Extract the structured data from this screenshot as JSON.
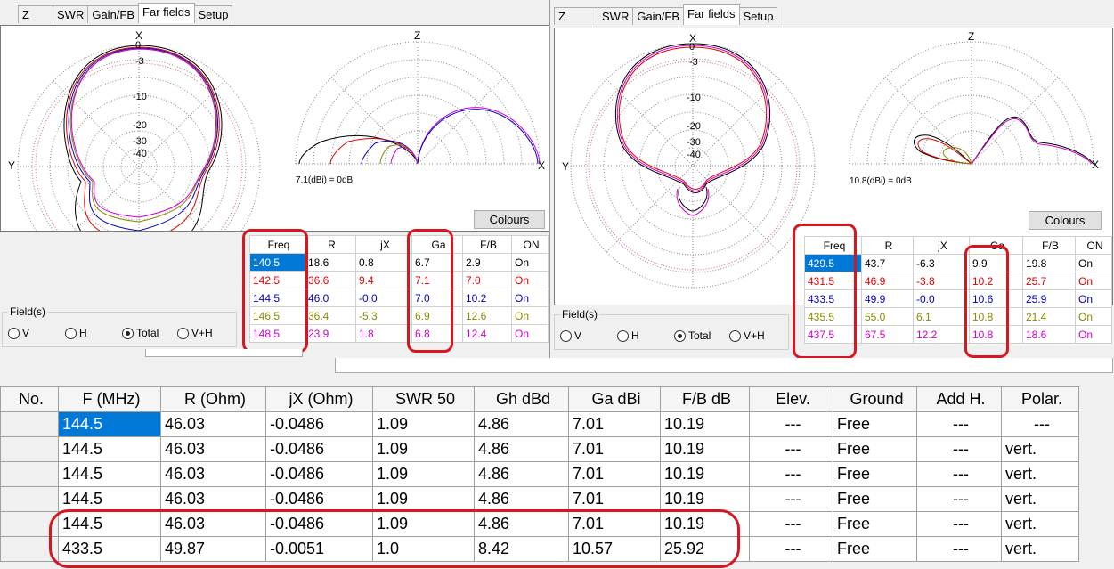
{
  "tabs": [
    "Z",
    "SWR",
    "Gain/FB",
    "Far fields",
    "Setup"
  ],
  "active_tab": "Far fields",
  "left": {
    "axis_labels": {
      "x_top": "X",
      "y_left": "Y",
      "z_top": "Z",
      "x_right": "X"
    },
    "ring_labels": [
      "0",
      "-3",
      "-10",
      "-20",
      "-30",
      "-40"
    ],
    "scale_text": "7.1(dBi) = 0dB",
    "colours_button": "Colours",
    "table": {
      "headers": [
        "Freq",
        "R",
        "jX",
        "Ga",
        "F/B",
        "ON"
      ],
      "rows": [
        {
          "color": "#000000",
          "cells": [
            "140.5",
            "18.6",
            "0.8",
            "6.7",
            "2.9",
            "On"
          ]
        },
        {
          "color": "#e00000",
          "cells": [
            "142.5",
            "36.6",
            "9.4",
            "7.1",
            "7.0",
            "On"
          ]
        },
        {
          "color": "#0000c8",
          "cells": [
            "144.5",
            "46.0",
            "-0.0",
            "7.0",
            "10.2",
            "On"
          ]
        },
        {
          "color": "#8a8a00",
          "cells": [
            "146.5",
            "36.4",
            "-5.3",
            "6.9",
            "12.6",
            "On"
          ]
        },
        {
          "color": "#d000d0",
          "cells": [
            "148.5",
            "23.9",
            "1.8",
            "6.8",
            "12.4",
            "On"
          ]
        }
      ]
    },
    "fields": {
      "legend": "Field(s)",
      "options": [
        "V",
        "H",
        "Total",
        "V+H"
      ],
      "selected": "Total"
    }
  },
  "right": {
    "axis_labels": {
      "x_top": "X",
      "y_left": "Y",
      "z_top": "Z",
      "x_right": "X"
    },
    "ring_labels": [
      "0",
      "-3",
      "-10",
      "-20",
      "-30",
      "-40"
    ],
    "scale_text": "10.8(dBi) = 0dB",
    "colours_button": "Colours",
    "table": {
      "headers": [
        "Freq",
        "R",
        "jX",
        "Ga",
        "F/B",
        "ON"
      ],
      "rows": [
        {
          "color": "#000000",
          "cells": [
            "429.5",
            "43.7",
            "-6.3",
            "9.9",
            "19.8",
            "On"
          ]
        },
        {
          "color": "#e00000",
          "cells": [
            "431.5",
            "46.9",
            "-3.8",
            "10.2",
            "25.7",
            "On"
          ]
        },
        {
          "color": "#0000c8",
          "cells": [
            "433.5",
            "49.9",
            "-0.0",
            "10.6",
            "25.9",
            "On"
          ]
        },
        {
          "color": "#8a8a00",
          "cells": [
            "435.5",
            "55.0",
            "6.1",
            "10.8",
            "21.4",
            "On"
          ]
        },
        {
          "color": "#d000d0",
          "cells": [
            "437.5",
            "67.5",
            "12.2",
            "10.8",
            "18.6",
            "On"
          ]
        }
      ]
    },
    "fields": {
      "legend": "Field(s)",
      "options": [
        "V",
        "H",
        "Total",
        "V+H"
      ],
      "selected": "Total"
    }
  },
  "results": {
    "headers": [
      "No.",
      "F (MHz)",
      "R (Ohm)",
      "jX (Ohm)",
      "SWR 50",
      "Gh dBd",
      "Ga dBi",
      "F/B dB",
      "Elev.",
      "Ground",
      "Add H.",
      "Polar."
    ],
    "rows": [
      [
        "",
        "144.5",
        "46.03",
        "-0.0486",
        "1.09",
        "4.86",
        "7.01",
        "10.19",
        "---",
        "Free",
        "---",
        "---"
      ],
      [
        "",
        "144.5",
        "46.03",
        "-0.0486",
        "1.09",
        "4.86",
        "7.01",
        "10.19",
        "---",
        "Free",
        "---",
        "vert."
      ],
      [
        "",
        "144.5",
        "46.03",
        "-0.0486",
        "1.09",
        "4.86",
        "7.01",
        "10.19",
        "---",
        "Free",
        "---",
        "vert."
      ],
      [
        "",
        "144.5",
        "46.03",
        "-0.0486",
        "1.09",
        "4.86",
        "7.01",
        "10.19",
        "---",
        "Free",
        "---",
        "vert."
      ],
      [
        "",
        "144.5",
        "46.03",
        "-0.0486",
        "1.09",
        "4.86",
        "7.01",
        "10.19",
        "---",
        "Free",
        "---",
        "vert."
      ],
      [
        "",
        "433.5",
        "49.87",
        "-0.0051",
        "1.0",
        "8.42",
        "10.57",
        "25.92",
        "---",
        "Free",
        "---",
        "vert."
      ]
    ]
  },
  "colors": {
    "highlight": "#d8161f",
    "selection": "#0078d7"
  }
}
